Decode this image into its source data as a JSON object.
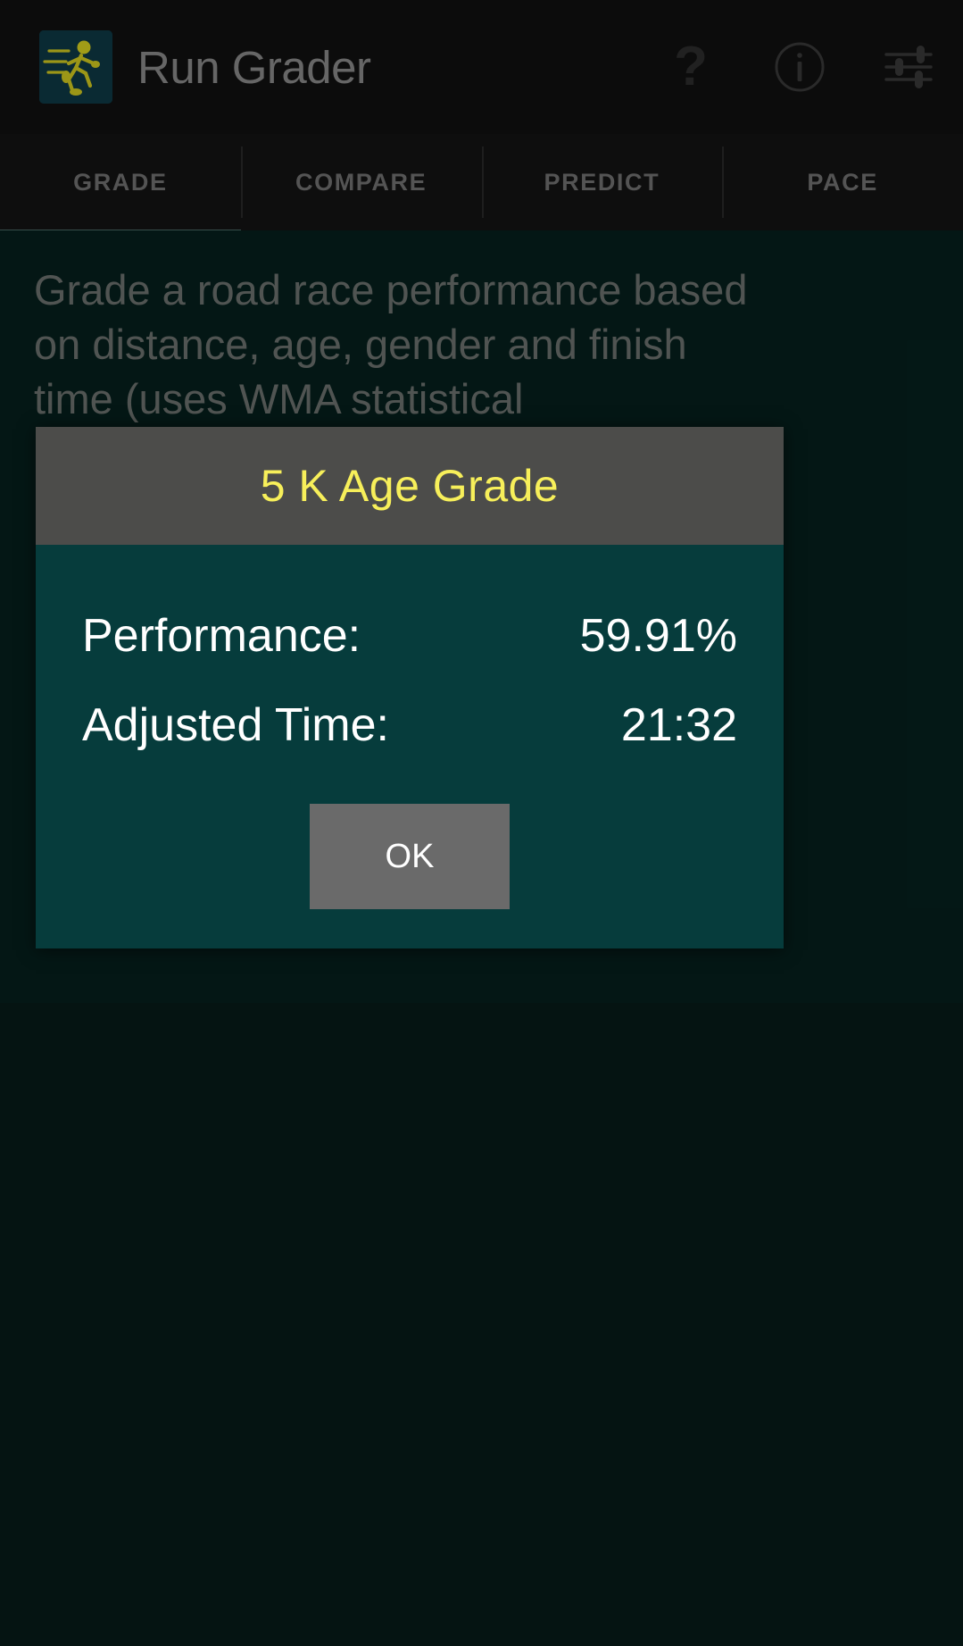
{
  "app": {
    "title": "Run Grader",
    "icon_name": "running-figure-icon",
    "background_color": "#0d0d0d",
    "content_background_color": "#06211e"
  },
  "actionbar": {
    "actions": [
      {
        "name": "help-icon",
        "glyph": "?",
        "label": "Help"
      },
      {
        "name": "info-icon",
        "glyph": "i",
        "label": "Info"
      },
      {
        "name": "settings-sliders-icon",
        "glyph": "",
        "label": "Settings"
      }
    ]
  },
  "tabs": {
    "items": [
      {
        "label": "GRADE",
        "active": true
      },
      {
        "label": "COMPARE",
        "active": false
      },
      {
        "label": "PREDICT",
        "active": false
      },
      {
        "label": "PACE",
        "active": false
      }
    ],
    "active_indicator_color": "#4e6d68",
    "inactive_text_color": "#757575"
  },
  "content": {
    "description": "Grade a road race performance based on distance, age, gender and finish time (uses WMA statistical"
  },
  "dialog": {
    "title": "5 K Age Grade",
    "title_color": "#f7ef5a",
    "header_background": "#4c4c4a",
    "body_background": "#063c3c",
    "rows": [
      {
        "label": "Performance:",
        "value": "59.91%"
      },
      {
        "label": "Adjusted Time:",
        "value": "21:32"
      }
    ],
    "ok_label": "OK",
    "ok_background": "#6a6a6a"
  }
}
